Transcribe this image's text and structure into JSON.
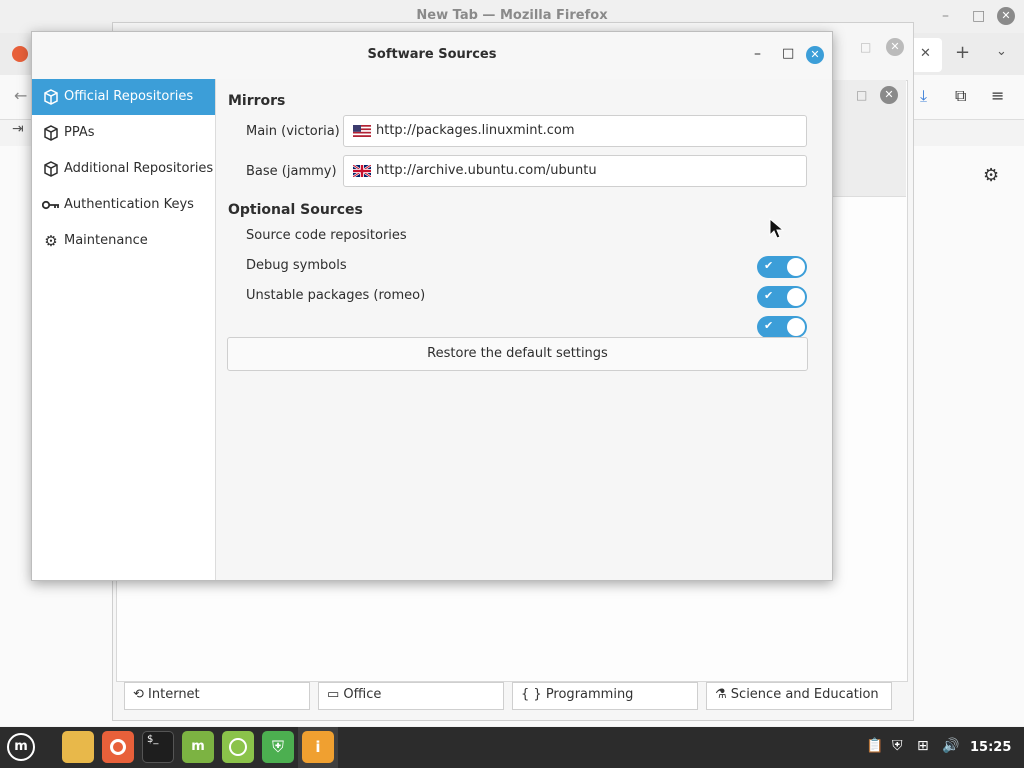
{
  "firefox": {
    "title": "New Tab — Mozilla Firefox"
  },
  "software_manager": {
    "categories": [
      "Internet",
      "Office",
      "Programming",
      "Science and Education"
    ]
  },
  "dialog": {
    "title": "Software Sources",
    "sidebar": [
      {
        "label": "Official Repositories",
        "icon": "package-icon",
        "selected": true
      },
      {
        "label": "PPAs",
        "icon": "package-icon",
        "selected": false
      },
      {
        "label": "Additional Repositories",
        "icon": "package-icon",
        "selected": false
      },
      {
        "label": "Authentication Keys",
        "icon": "key-icon",
        "selected": false
      },
      {
        "label": "Maintenance",
        "icon": "gear-icon",
        "selected": false
      }
    ],
    "mirrors": {
      "heading": "Mirrors",
      "main_label": "Main (victoria)",
      "main_url": "http://packages.linuxmint.com",
      "main_flag": "us-flag-icon",
      "base_label": "Base (jammy)",
      "base_url": "http://archive.ubuntu.com/ubuntu",
      "base_flag": "uk-flag-icon"
    },
    "optional": {
      "heading": "Optional Sources",
      "items": [
        {
          "label": "Source code repositories",
          "enabled": true
        },
        {
          "label": "Debug symbols",
          "enabled": true
        },
        {
          "label": "Unstable packages (romeo)",
          "enabled": true
        }
      ]
    },
    "restore_label": "Restore the default settings"
  },
  "taskbar": {
    "clock": "15:25"
  },
  "colors": {
    "accent": "#3c9ed8",
    "taskbar": "#2c2c2c"
  }
}
